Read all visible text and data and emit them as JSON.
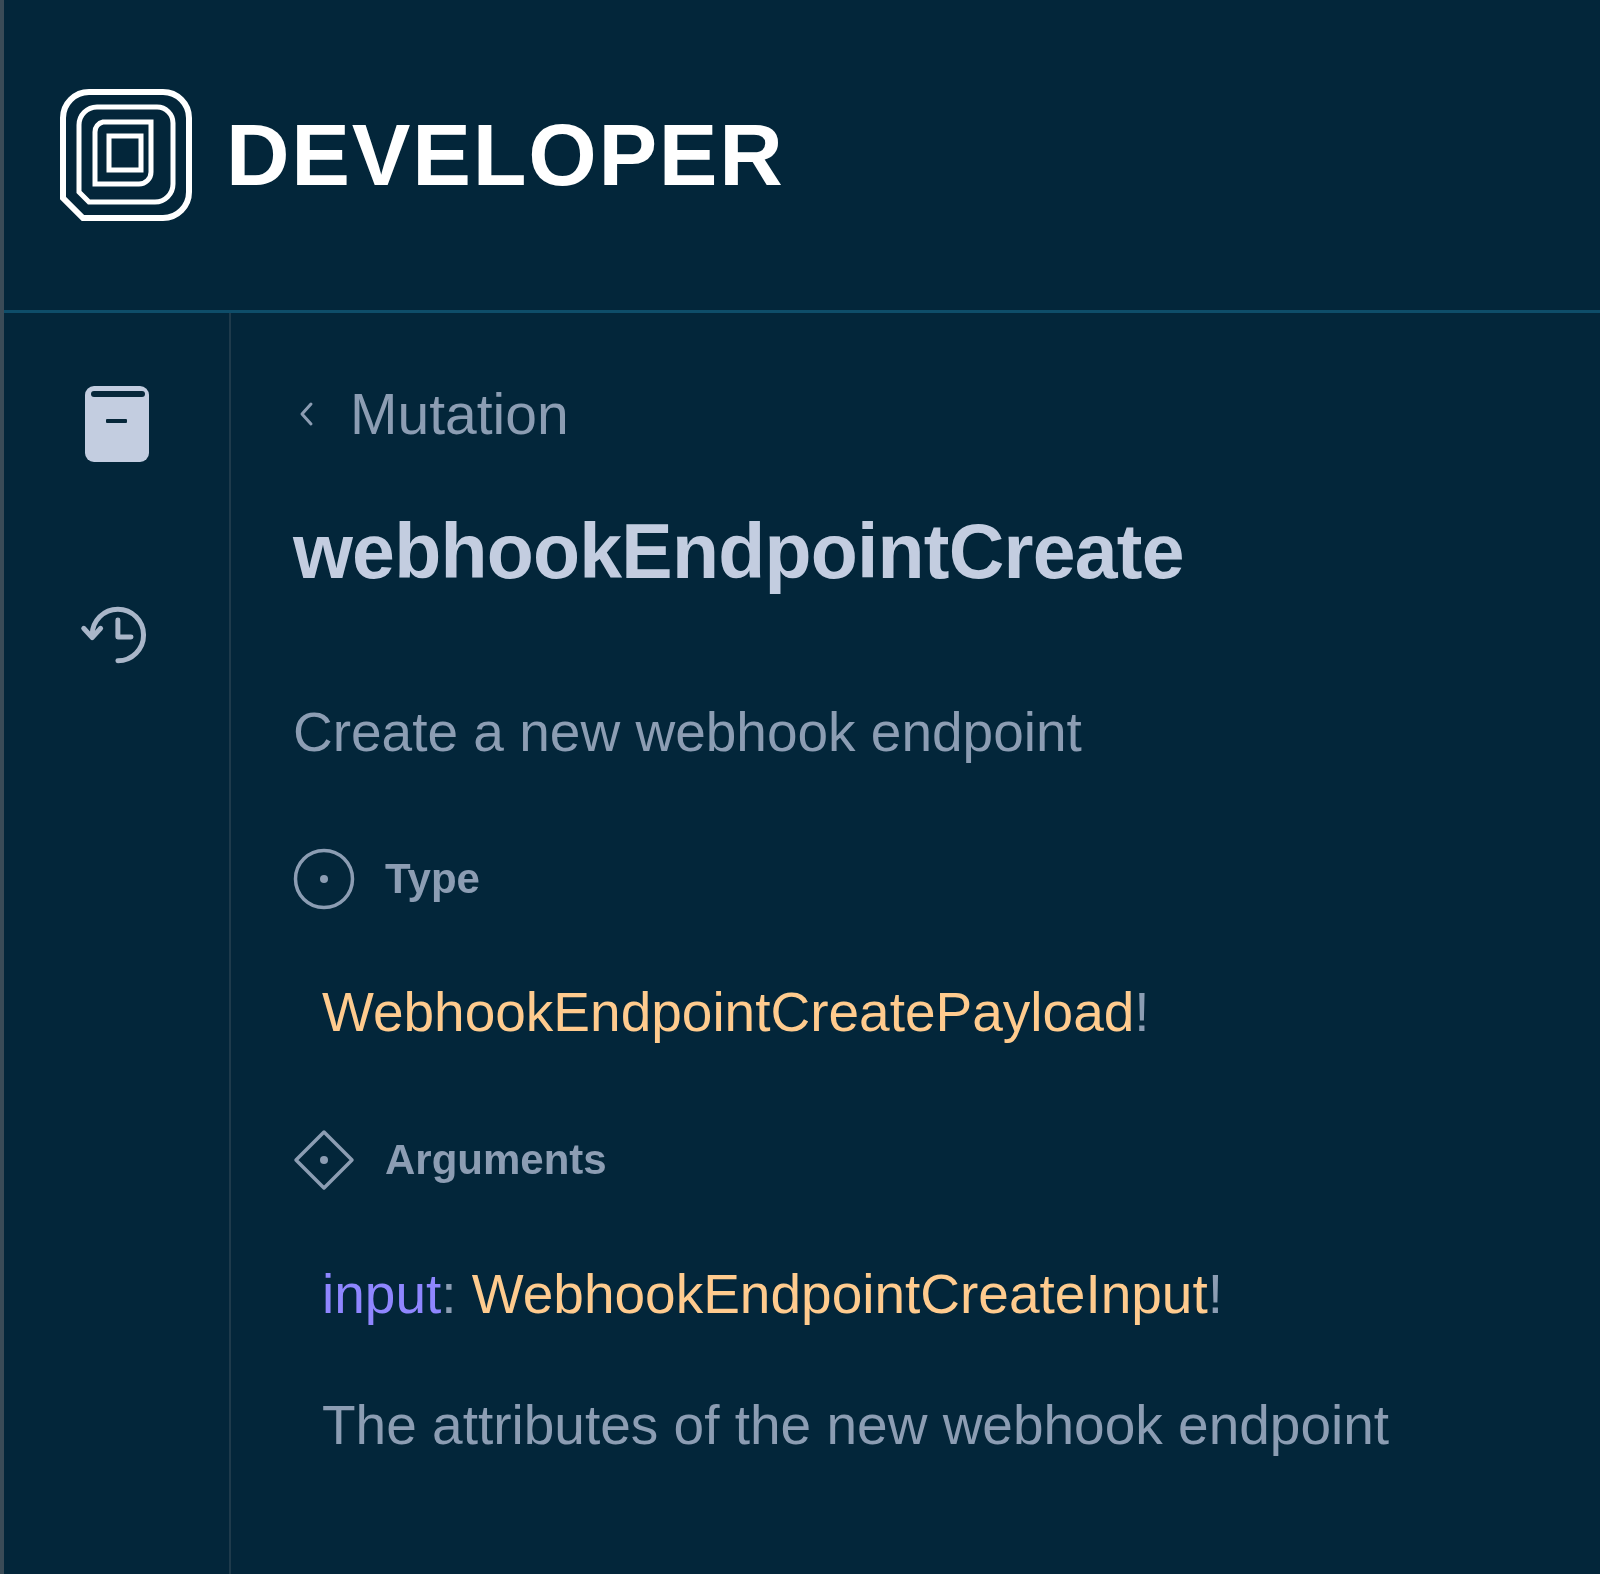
{
  "header": {
    "brand": "DEVELOPER"
  },
  "sidebar": {
    "items": [
      {
        "kind": "docs"
      },
      {
        "kind": "history"
      }
    ]
  },
  "breadcrumb": {
    "back_label": "Mutation"
  },
  "title": "webhookEndpointCreate",
  "description": "Create a new webhook endpoint",
  "sections": [
    {
      "kind": "type",
      "heading": "Type",
      "entries": [
        {
          "type_name": "WebhookEndpointCreatePayload",
          "non_null_mark": "!"
        }
      ]
    },
    {
      "kind": "arguments",
      "heading": "Arguments",
      "entries": [
        {
          "arg_name": "input",
          "separator": ":",
          "type_name": "WebhookEndpointCreateInput",
          "non_null_mark": "!",
          "description": "The attributes of the new webhook endpoint"
        }
      ]
    }
  ]
}
